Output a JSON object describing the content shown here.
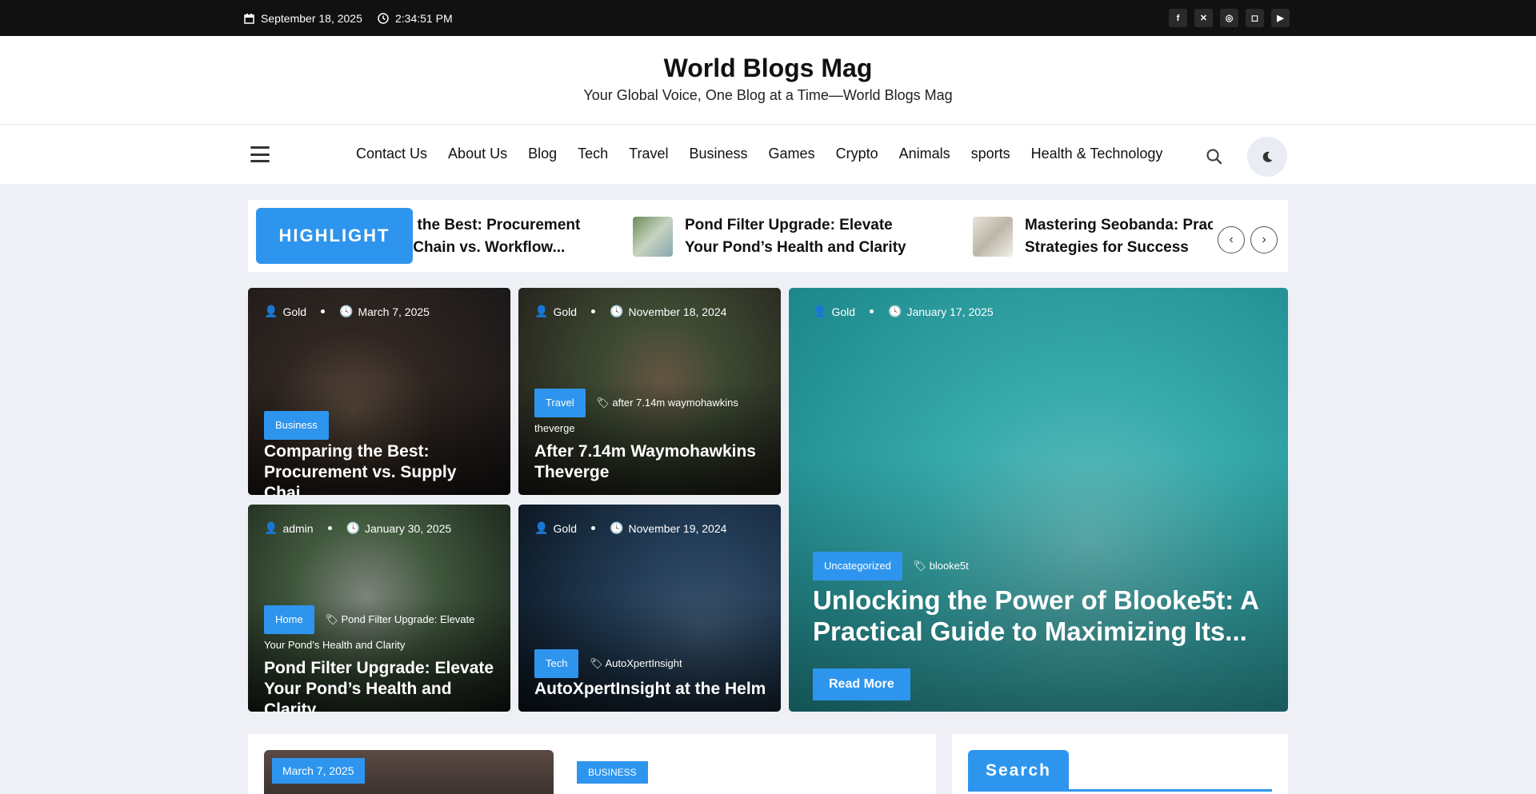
{
  "topbar": {
    "date": "September 18, 2025",
    "time": "2:34:51 PM",
    "social": [
      "facebook",
      "x",
      "dribbble",
      "instagram",
      "youtube"
    ]
  },
  "header": {
    "title": "World Blogs Mag",
    "tagline": "Your Global Voice, One Blog at a Time—World Blogs Mag"
  },
  "nav": {
    "items": [
      "Contact Us",
      "About Us",
      "Blog",
      "Tech",
      "Travel",
      "Business",
      "Games",
      "Crypto",
      "Animals",
      "sports",
      "Health & Technology"
    ]
  },
  "ticker": {
    "badge": "HIGHLIGHT",
    "items": [
      {
        "title": "Comparing the Best: Procurement vs. Supply Chain vs. Workflow..."
      },
      {
        "title": "Pond Filter Upgrade: Elevate Your Pond’s Health and Clarity"
      },
      {
        "title": "Mastering Seobanda: Practical Strategies for Success"
      }
    ]
  },
  "cards": [
    {
      "author": "Gold",
      "date": "March 7, 2025",
      "category": "Business",
      "tag": "",
      "title": "Comparing the Best: Procurement vs. Supply Chai..."
    },
    {
      "author": "Gold",
      "date": "November 18, 2024",
      "category": "Travel",
      "tag": "after 7.14m waymohawkins theverge",
      "title": "After 7.14m Waymohawkins Theverge"
    },
    {
      "author": "admin",
      "date": "January 30, 2025",
      "category": "Home",
      "tag": "Pond Filter Upgrade: Elevate Your Pond’s Health and Clarity",
      "title": "Pond Filter Upgrade: Elevate Your Pond’s Health and Clarity"
    },
    {
      "author": "Gold",
      "date": "November 19, 2024",
      "category": "Tech",
      "tag": "AutoXpertInsight",
      "title": "AutoXpertInsight at the Helm"
    },
    {
      "author": "Gold",
      "date": "January 17, 2025",
      "category": "Uncategorized",
      "tag": "blooke5t",
      "title": "Unlocking the Power of Blooke5t: A Practical Guide to Maximizing Its...",
      "button": "Read More"
    }
  ],
  "lower": {
    "date": "March 7, 2025",
    "category": "BUSINESS",
    "search_title": "Search"
  },
  "colors": {
    "accent": "#2e95ee",
    "topbar": "#111111"
  }
}
